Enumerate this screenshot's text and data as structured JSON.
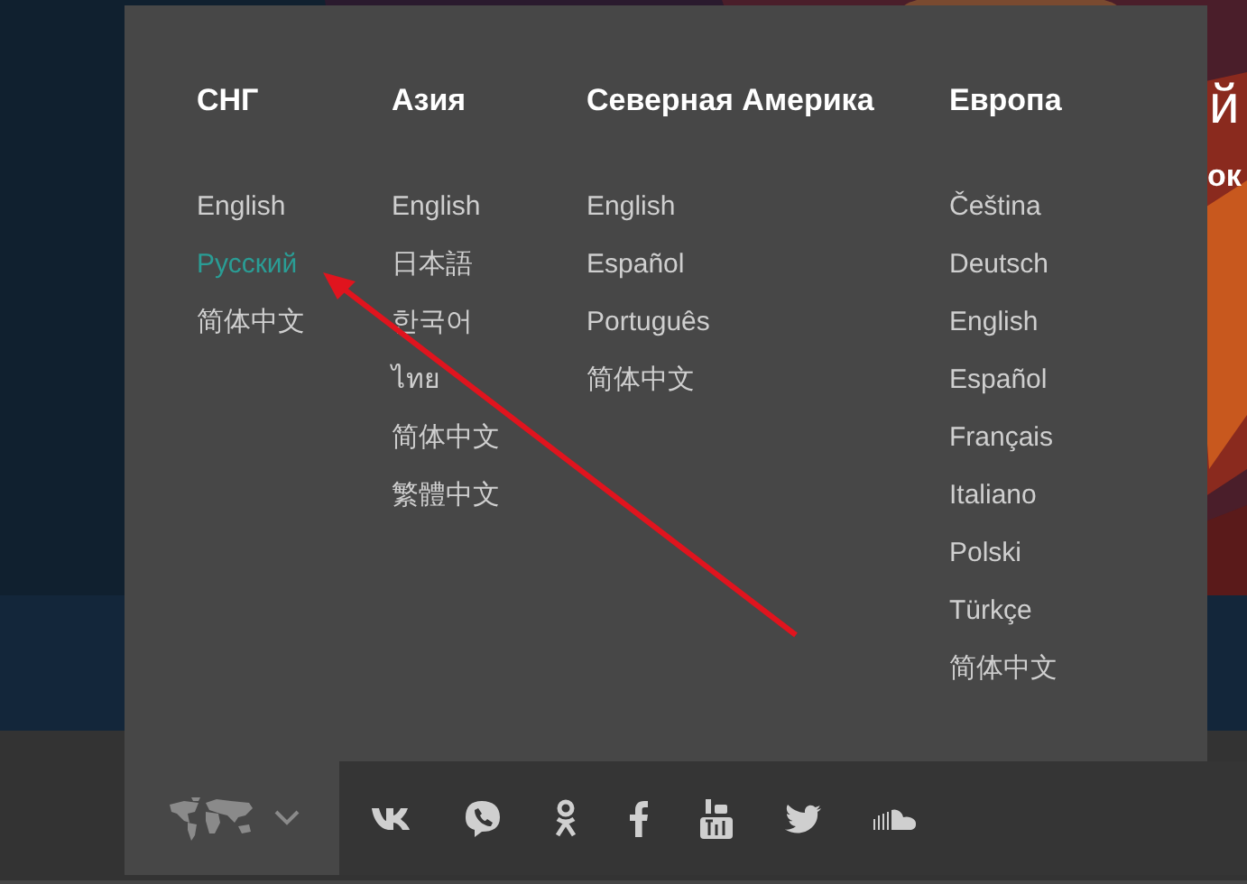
{
  "hero": {
    "kind": "picture",
    "heading_fragment": "й",
    "subheading_fragment": "ок"
  },
  "regions": [
    {
      "title": "СНГ",
      "languages": [
        {
          "label": "English",
          "selected": false
        },
        {
          "label": "Русский",
          "selected": true
        },
        {
          "label": "简体中文",
          "selected": false
        }
      ]
    },
    {
      "title": "Азия",
      "languages": [
        {
          "label": "English",
          "selected": false
        },
        {
          "label": "日本語",
          "selected": false
        },
        {
          "label": "한국어",
          "selected": false
        },
        {
          "label": "ไทย",
          "selected": false
        },
        {
          "label": "简体中文",
          "selected": false
        },
        {
          "label": "繁體中文",
          "selected": false
        }
      ]
    },
    {
      "title": "Северная Америка",
      "languages": [
        {
          "label": "English",
          "selected": false
        },
        {
          "label": "Español",
          "selected": false
        },
        {
          "label": "Português",
          "selected": false
        },
        {
          "label": "简体中文",
          "selected": false
        }
      ]
    },
    {
      "title": "Европа",
      "languages": [
        {
          "label": "Čeština",
          "selected": false
        },
        {
          "label": "Deutsch",
          "selected": false
        },
        {
          "label": "English",
          "selected": false
        },
        {
          "label": "Español",
          "selected": false
        },
        {
          "label": "Français",
          "selected": false
        },
        {
          "label": "Italiano",
          "selected": false
        },
        {
          "label": "Polski",
          "selected": false
        },
        {
          "label": "Türkçe",
          "selected": false
        },
        {
          "label": "简体中文",
          "selected": false
        }
      ]
    }
  ],
  "language_menu": {
    "expanded": true
  }
}
